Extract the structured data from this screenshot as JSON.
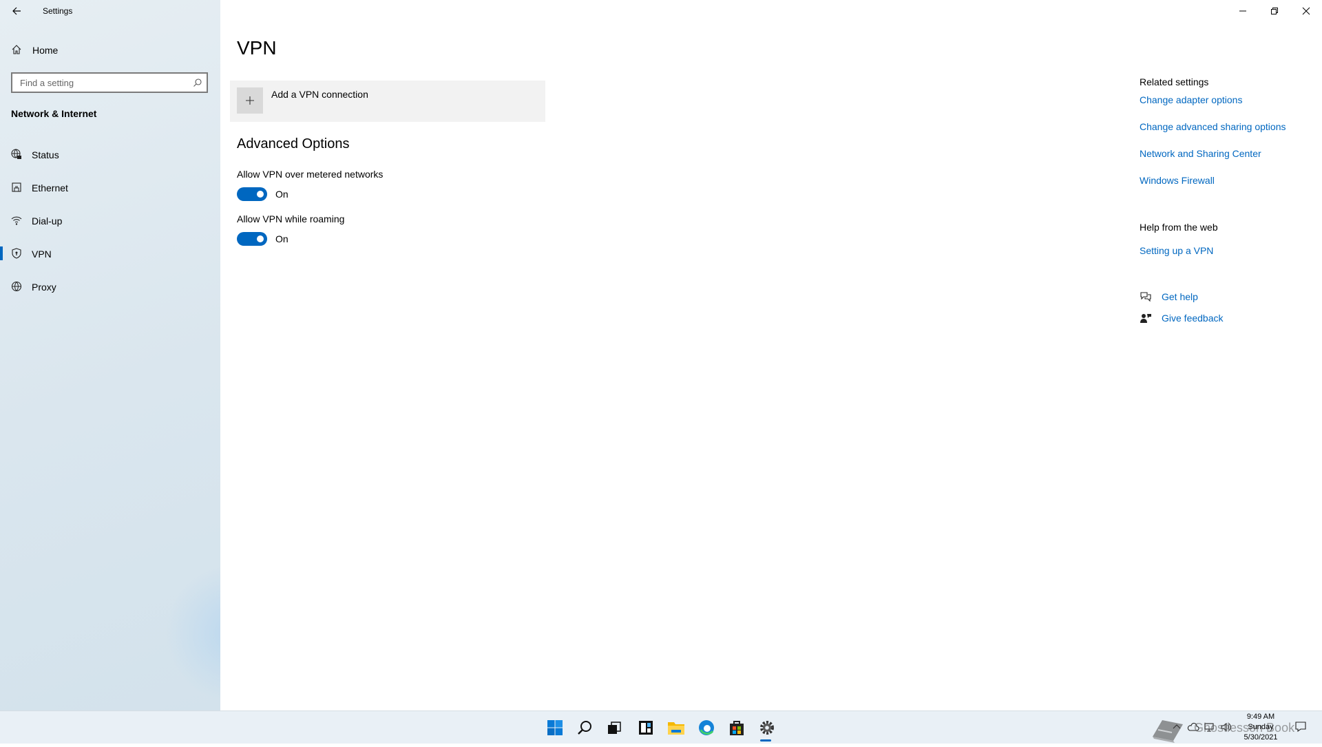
{
  "window": {
    "app_title": "Settings"
  },
  "sidebar": {
    "home_label": "Home",
    "search_placeholder": "Find a setting",
    "section_title": "Network & Internet",
    "items": [
      {
        "label": "Status",
        "icon": "globe-status-icon",
        "selected": false
      },
      {
        "label": "Ethernet",
        "icon": "ethernet-icon",
        "selected": false
      },
      {
        "label": "Dial-up",
        "icon": "dialup-icon",
        "selected": false
      },
      {
        "label": "VPN",
        "icon": "vpn-shield-icon",
        "selected": true
      },
      {
        "label": "Proxy",
        "icon": "globe-icon",
        "selected": false
      }
    ]
  },
  "main": {
    "title": "VPN",
    "add_vpn_label": "Add a VPN connection",
    "advanced_title": "Advanced Options",
    "options": [
      {
        "label": "Allow VPN over metered networks",
        "state": "On"
      },
      {
        "label": "Allow VPN while roaming",
        "state": "On"
      }
    ]
  },
  "related": {
    "heading": "Related settings",
    "links": [
      "Change adapter options",
      "Change advanced sharing options",
      "Network and Sharing Center",
      "Windows Firewall"
    ]
  },
  "help_web": {
    "heading": "Help from the web",
    "links": [
      "Setting up a VPN"
    ]
  },
  "support": {
    "get_help": "Get help",
    "give_feedback": "Give feedback"
  },
  "taskbar": {
    "apps": [
      "start-icon",
      "search-icon",
      "task-view-icon",
      "widgets-icon",
      "file-explorer-icon",
      "edge-icon",
      "store-icon",
      "settings-icon"
    ],
    "clock_time": "9:49 AM",
    "clock_day": "Sunday",
    "clock_date": "5/30/2021"
  },
  "watermark": "Ghostlesson Book"
}
